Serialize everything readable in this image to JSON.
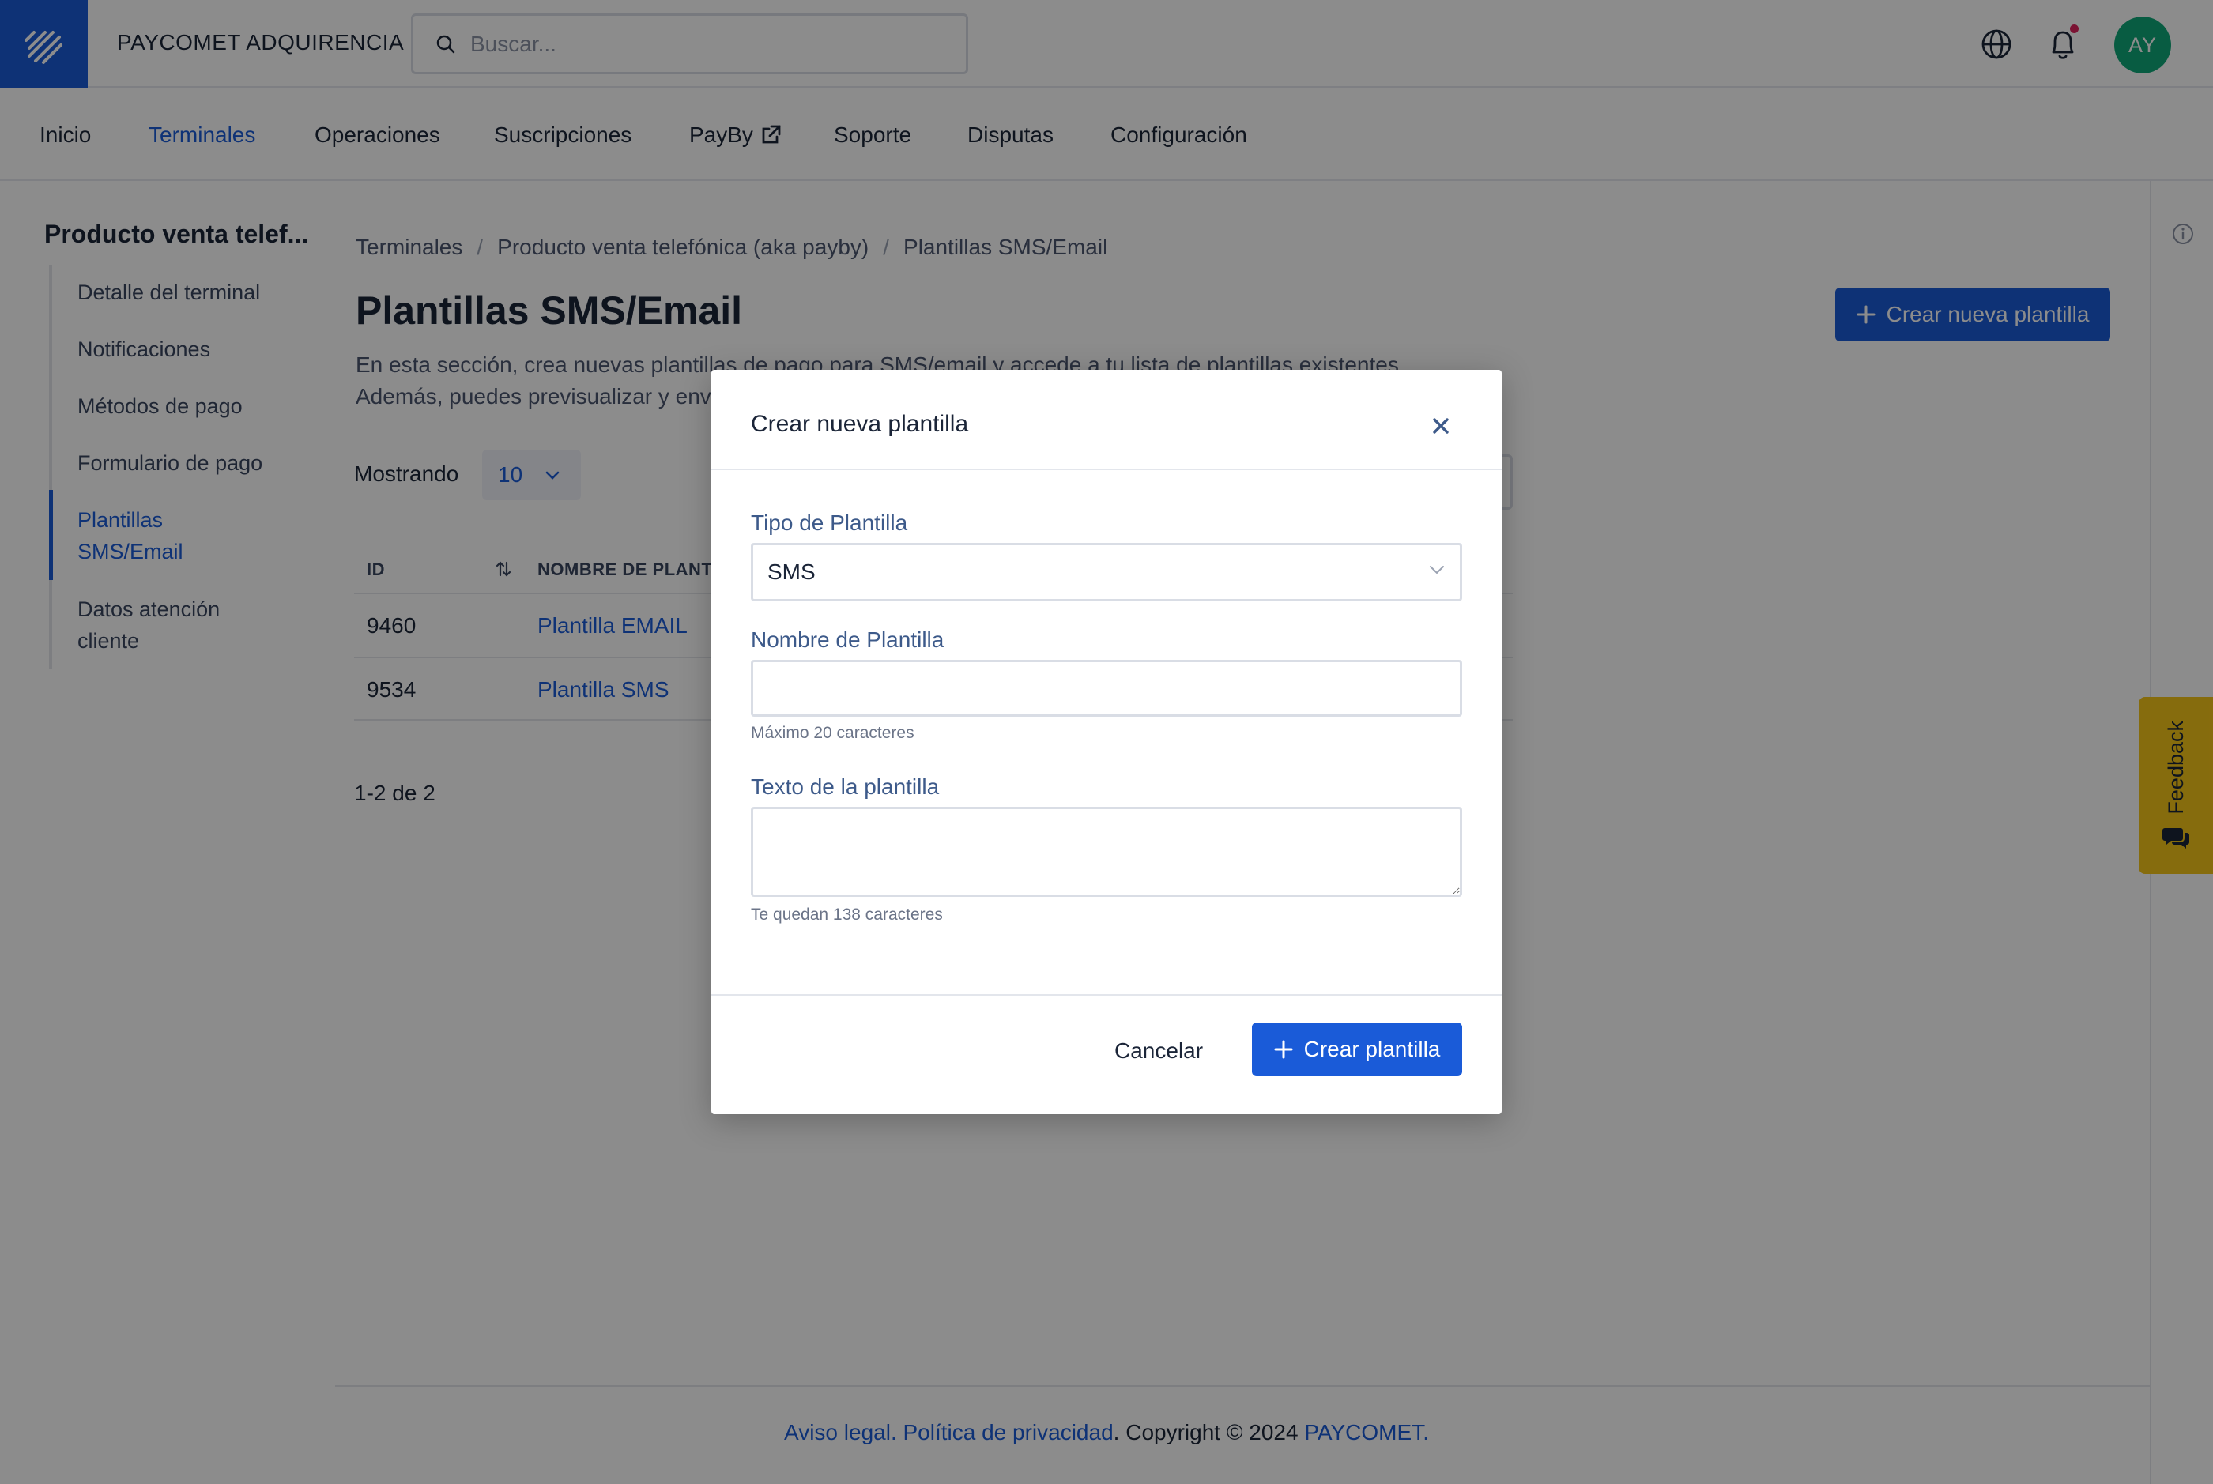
{
  "header": {
    "brand": "PAYCOMET ADQUIRENCIA",
    "search_placeholder": "Buscar...",
    "avatar_initials": "AY",
    "has_notification": true
  },
  "nav": {
    "items": [
      {
        "label": "Inicio",
        "active": false
      },
      {
        "label": "Terminales",
        "active": true
      },
      {
        "label": "Operaciones",
        "active": false
      },
      {
        "label": "Suscripciones",
        "active": false
      },
      {
        "label": "PayBy",
        "active": false,
        "external_icon": "external-link-icon"
      },
      {
        "label": "Soporte",
        "active": false
      },
      {
        "label": "Disputas",
        "active": false
      },
      {
        "label": "Configuración",
        "active": false
      }
    ]
  },
  "sidebar": {
    "title": "Producto venta telef...",
    "items": [
      {
        "label": "Detalle del terminal",
        "active": false
      },
      {
        "label": "Notificaciones",
        "active": false
      },
      {
        "label": "Métodos de pago",
        "active": false
      },
      {
        "label": "Formulario de pago",
        "active": false
      },
      {
        "label": "Plantillas SMS/Email",
        "active": true
      },
      {
        "label": "Datos atención cliente",
        "active": false
      }
    ]
  },
  "breadcrumb": [
    "Terminales",
    "Producto venta telefónica (aka payby)",
    "Plantillas SMS/Email"
  ],
  "page": {
    "title": "Plantillas SMS/Email",
    "description": "En esta sección, crea nuevas plantillas de pago para SMS/email y accede a tu lista de plantillas existentes. Además, puedes previsualizar y enviar prueba",
    "new_button_label": "Crear nueva plantilla"
  },
  "table": {
    "showing_label": "Mostrando",
    "per_page": "10",
    "columns": [
      "ID",
      "NOMBRE DE PLANTILL"
    ],
    "rows": [
      {
        "id": "9460",
        "name": "Plantilla EMAIL"
      },
      {
        "id": "9534",
        "name": "Plantilla SMS"
      }
    ],
    "pagination": {
      "range": "1-2",
      "of": "de",
      "total": "2"
    }
  },
  "feedback_label": "Feedback",
  "footer": {
    "legal": "Aviso legal",
    "privacy": "Política de privacidad",
    "copyright": "Copyright © 2024",
    "company": "PAYCOMET"
  },
  "modal": {
    "title": "Crear nueva plantilla",
    "type_label": "Tipo de Plantilla",
    "type_value": "SMS",
    "name_label": "Nombre de Plantilla",
    "name_value": "",
    "name_help": "Máximo 20 caracteres",
    "text_label": "Texto de la plantilla",
    "text_value": "",
    "text_help": "Te quedan 138 caracteres",
    "cancel_label": "Cancelar",
    "submit_label": "Crear plantilla"
  },
  "colors": {
    "primary": "#1a5bd8",
    "avatar": "#10a878",
    "feedback": "#f5c518",
    "notification": "#e0245e"
  }
}
